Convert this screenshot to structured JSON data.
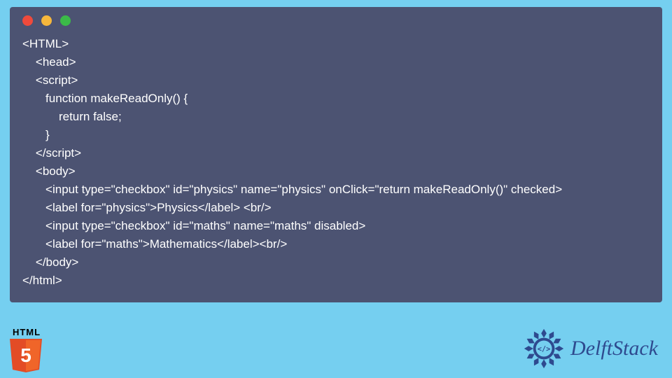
{
  "window": {
    "dots": [
      "red",
      "yellow",
      "green"
    ]
  },
  "code": {
    "lines": [
      "<HTML>",
      "    <head>",
      "    <script>",
      "       function makeReadOnly() {",
      "           return false;",
      "       }",
      "    </script>",
      "    <body>",
      "       <input type=\"checkbox\" id=\"physics\" name=\"physics\" onClick=\"return makeReadOnly()\" checked>",
      "       <label for=\"physics\">Physics</label> <br/>",
      "       <input type=\"checkbox\" id=\"maths\" name=\"maths\" disabled>",
      "       <label for=\"maths\">Mathematics</label><br/>",
      "    </body>",
      "</html>"
    ]
  },
  "logos": {
    "html5_label": "HTML",
    "html5_number": "5",
    "brand_name": "DelftStack"
  },
  "colors": {
    "page_bg": "#75cff0",
    "window_bg": "#4c5372",
    "code_text": "#ffffff",
    "brand_text": "#2e4a8f"
  }
}
